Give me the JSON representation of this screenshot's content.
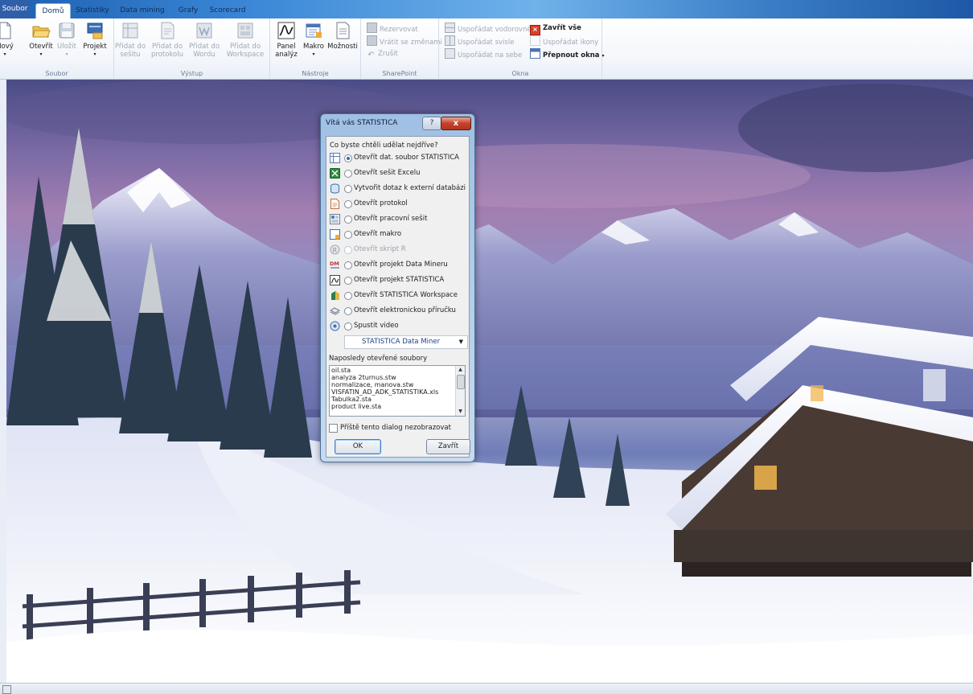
{
  "ribbon_tabs": {
    "file": "Soubor",
    "home": "Domů",
    "statistics": "Statistiky",
    "data_mining": "Data mining",
    "graphs": "Grafy",
    "scorecard": "Scorecard"
  },
  "file_group": {
    "label": "Soubor",
    "new": "Nový",
    "open": "Otevřít",
    "save": "Uložit",
    "project": "Projekt"
  },
  "output_group": {
    "label": "Výstup",
    "add_workbook": "Přidat do sešitu",
    "add_report": "Přidat do protokolu",
    "add_word": "Přidat do Wordu",
    "add_workspace": "Přidat do Workspace"
  },
  "tools_group": {
    "label": "Nástroje",
    "panel": "Panel analýz",
    "macro": "Makro",
    "options": "Možnosti"
  },
  "sharepoint_group": {
    "label": "SharePoint",
    "reserve": "Rezervovat",
    "undo_changes": "Vrátit se změnami",
    "cancel": "Zrušit"
  },
  "windows_group": {
    "label": "Okna",
    "tile_horizontal": "Uspořádat vodorovně",
    "tile_vertical": "Uspořádat svisle",
    "cascade": "Uspořádat na sebe",
    "close_all": "Zavřít vše",
    "arrange_icons": "Uspořádat ikony",
    "switch_windows": "Přepnout okna"
  },
  "dialog": {
    "title": "Vítá vás STATISTICA",
    "help_label": "?",
    "close_label": "x",
    "question": "Co byste chtěli udělat nejdříve?",
    "options": [
      "Otevřít dat. soubor STATISTICA",
      "Otevřít sešit Excelu",
      "Vytvořit dotaz k externí databázi",
      "Otevřít protokol",
      "Otevřít pracovní sešit",
      "Otevřít makro",
      "Otevřít skript R",
      "Otevřít projekt Data Mineru",
      "Otevřít projekt STATISTICA",
      "Otevřít STATISTICA Workspace",
      "Otevřít elektronickou příručku",
      "Spustit video"
    ],
    "selected_option": "Otevřít dat. soubor STATISTICA",
    "video_select": "STATISTICA Data Miner",
    "recent_label": "Naposledy otevřené soubory",
    "recent_files": [
      "oil.sta",
      "analyza 2turnus.stw",
      "normalizace, manova.stw",
      "VISFATIN_AD_ADK_STATISTIKA.xls",
      "Tabulka2.sta",
      "product live.sta"
    ],
    "dont_show": "Příště tento dialog nezobrazovat",
    "ok": "OK",
    "close": "Zavřít"
  }
}
